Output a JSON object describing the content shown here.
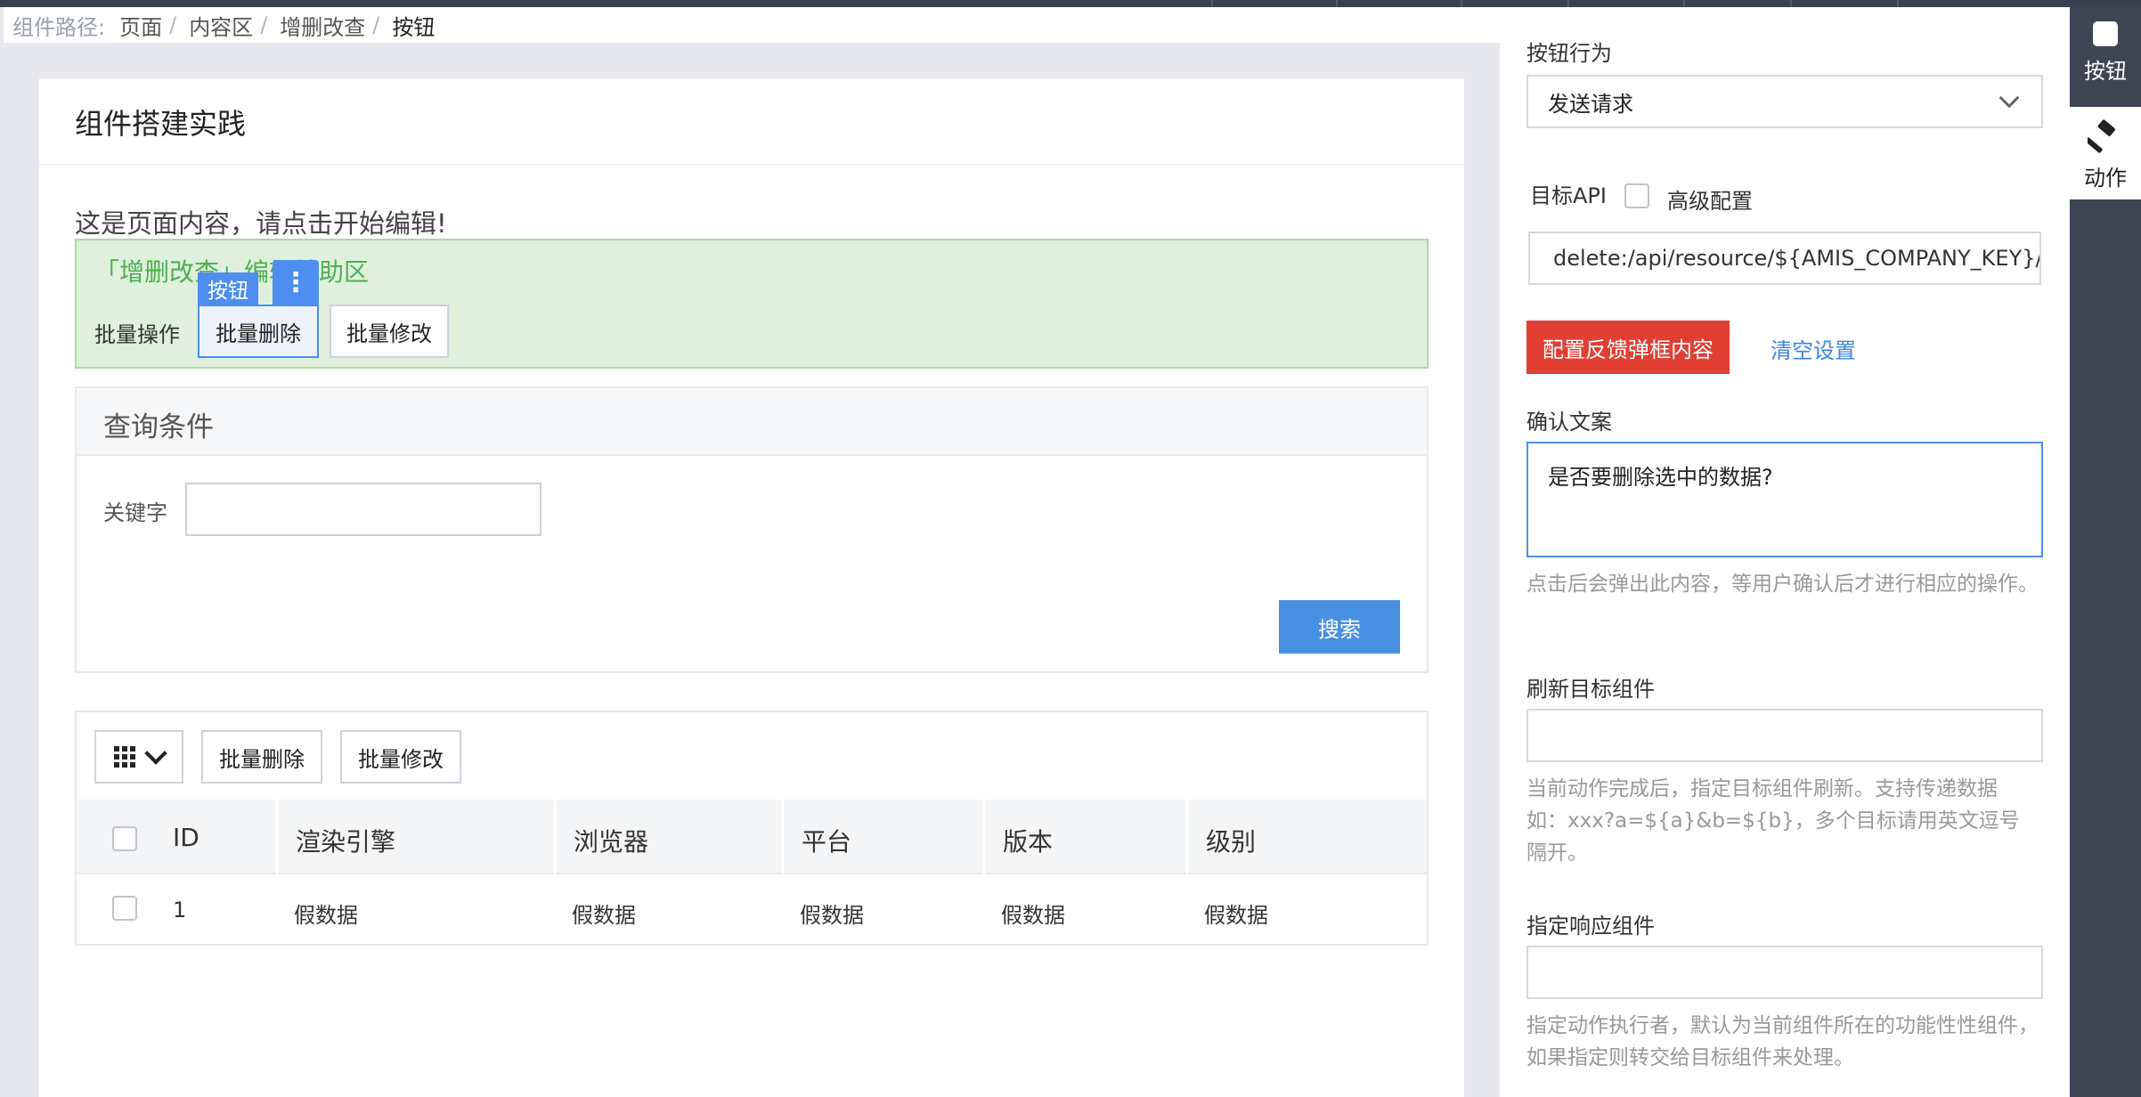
{
  "breadcrumb": {
    "label": "组件路径:",
    "items": [
      "页面",
      "内容区",
      "增删改查",
      "按钮"
    ],
    "separator": "/"
  },
  "page": {
    "title": "组件搭建实践",
    "content_text": "这是页面内容，请点击开始编辑!",
    "helper_area": {
      "title": "「增删改查」编辑辅助区",
      "label": "批量操作",
      "selected_tag": "按钮",
      "more_icon": "⋮",
      "buttons": [
        "批量删除",
        "批量修改"
      ]
    },
    "query": {
      "title": "查询条件",
      "keyword_label": "关键字",
      "keyword_value": "",
      "search_button": "搜索"
    },
    "table": {
      "column_toggle_icon": "grid-icon",
      "toolbar_buttons": [
        "批量删除",
        "批量修改"
      ],
      "columns": [
        "ID",
        "渲染引擎",
        "浏览器",
        "平台",
        "版本",
        "级别"
      ],
      "rows": [
        [
          "1",
          "假数据",
          "假数据",
          "假数据",
          "假数据",
          "假数据"
        ]
      ]
    }
  },
  "panel": {
    "button_behavior_label": "按钮行为",
    "button_behavior_value": "发送请求",
    "target_api_label": "目标API",
    "advanced_label": "高级配置",
    "advanced_checked": false,
    "api_value": "delete:/api/resource/${AMIS_COMPANY_KEY}/",
    "feedback_button": "配置反馈弹框内容",
    "clear_link": "清空设置",
    "confirm_label": "确认文案",
    "confirm_value": "是否要删除选中的数据?",
    "confirm_hint": "点击后会弹出此内容，等用户确认后才进行相应的操作。",
    "reload_label": "刷新目标组件",
    "reload_value": "",
    "reload_hint_1": "当前动作完成后，指定目标组件刷新。支持传递数据",
    "reload_hint_2": "如：xxx?a=${a}&b=${b}，多个目标请用英文逗号",
    "reload_hint_3": "隔开。",
    "target_label": "指定响应组件",
    "target_value": "",
    "target_hint": "指定动作执行者，默认为当前组件所在的功能性性组件，如果指定则转交给目标组件来处理。"
  },
  "sidebar_tabs": [
    {
      "label": "按钮",
      "icon": "square-icon",
      "active": false
    },
    {
      "label": "动作",
      "icon": "gavel-icon",
      "active": true
    }
  ],
  "colors": {
    "accent": "#4a90e2",
    "danger": "#e23f34",
    "helper_bg": "#dff0dc",
    "helper_text": "#4caf50",
    "dark_bar": "#3f4453"
  }
}
